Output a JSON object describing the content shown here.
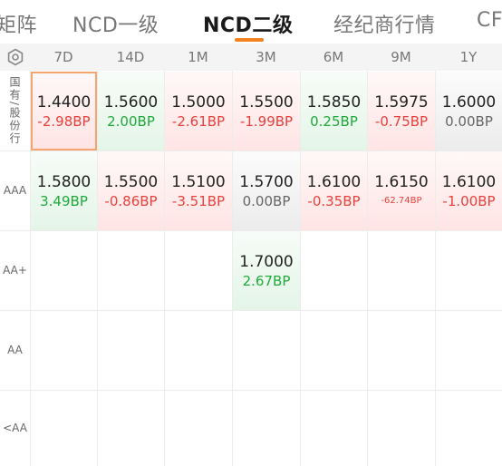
{
  "tabs": [
    {
      "label": "矩阵",
      "active": false
    },
    {
      "label": "NCD一级",
      "active": false
    },
    {
      "label": "NCD二级",
      "active": true
    },
    {
      "label": "经纪商行情",
      "active": false
    },
    {
      "label": "CF",
      "active": false
    }
  ],
  "columns": [
    "7D",
    "14D",
    "1M",
    "3M",
    "6M",
    "9M",
    "1Y"
  ],
  "rows": [
    {
      "label": "国有/股份行",
      "cells": [
        {
          "rate": "1.4400",
          "change": "-2.98BP",
          "trend": "down",
          "selected": true
        },
        {
          "rate": "1.5600",
          "change": "2.00BP",
          "trend": "up"
        },
        {
          "rate": "1.5000",
          "change": "-2.61BP",
          "trend": "down"
        },
        {
          "rate": "1.5500",
          "change": "-1.99BP",
          "trend": "down"
        },
        {
          "rate": "1.5850",
          "change": "0.25BP",
          "trend": "up"
        },
        {
          "rate": "1.5975",
          "change": "-0.75BP",
          "trend": "down"
        },
        {
          "rate": "1.6000",
          "change": "0.00BP",
          "trend": "flat"
        }
      ]
    },
    {
      "label": "AAA",
      "cells": [
        {
          "rate": "1.5800",
          "change": "3.49BP",
          "trend": "up"
        },
        {
          "rate": "1.5500",
          "change": "-0.86BP",
          "trend": "down"
        },
        {
          "rate": "1.5100",
          "change": "-3.51BP",
          "trend": "down"
        },
        {
          "rate": "1.5700",
          "change": "0.00BP",
          "trend": "flat"
        },
        {
          "rate": "1.6100",
          "change": "-0.35BP",
          "trend": "down"
        },
        {
          "rate": "1.6150",
          "change": "-62.74BP",
          "trend": "down"
        },
        {
          "rate": "1.6100",
          "change": "-1.00BP",
          "trend": "down"
        }
      ]
    },
    {
      "label": "AA+",
      "cells": [
        null,
        null,
        null,
        {
          "rate": "1.7000",
          "change": "2.67BP",
          "trend": "up"
        },
        null,
        null,
        null
      ]
    },
    {
      "label": "AA",
      "cells": [
        null,
        null,
        null,
        null,
        null,
        null,
        null
      ]
    },
    {
      "label": "<AA",
      "cells": [
        null,
        null,
        null,
        null,
        null,
        null,
        null
      ]
    }
  ],
  "colors": {
    "accent": "#f58220",
    "up": "#1faa3a",
    "down": "#e8413c",
    "flat": "#666666"
  }
}
